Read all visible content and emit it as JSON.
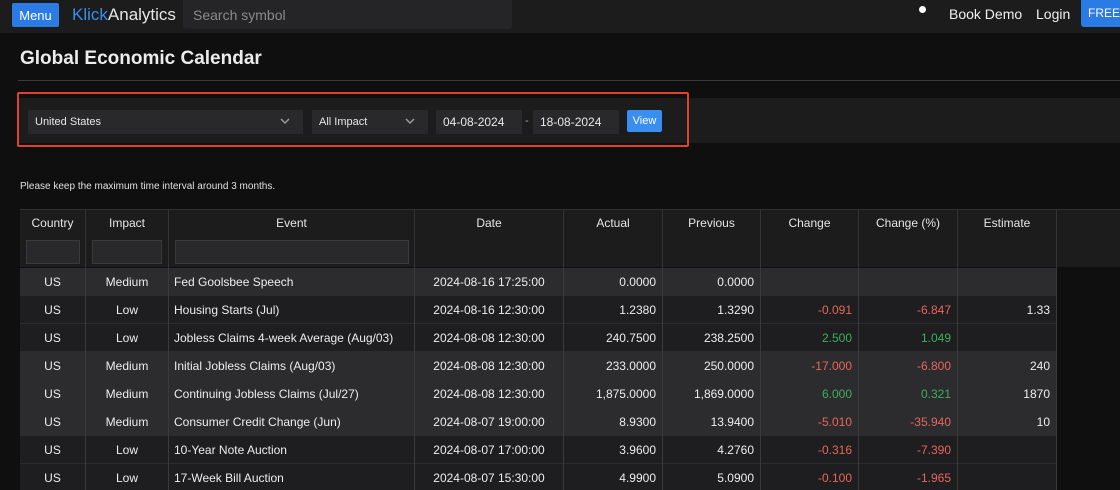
{
  "topbar": {
    "menu_label": "Menu",
    "logo_part1": "Klick",
    "logo_part2": "Analytics",
    "search_placeholder": "Search symbol",
    "book_demo": "Book Demo",
    "login": "Login",
    "free_trial": "FREE T"
  },
  "page": {
    "title": "Global Economic Calendar",
    "note": "Please keep the maximum time interval around 3 months."
  },
  "filters": {
    "country": "United States",
    "impact": "All Impact",
    "date_from": "04-08-2024",
    "date_separator": "-",
    "date_to": "18-08-2024",
    "view_label": "View"
  },
  "table": {
    "headers": [
      "Country",
      "Impact",
      "Event",
      "Date",
      "Actual",
      "Previous",
      "Change",
      "Change (%)",
      "Estimate"
    ],
    "rows": [
      {
        "country": "US",
        "impact": "Medium",
        "event": "Fed Goolsbee Speech",
        "date": "2024-08-16 17:25:00",
        "actual": "0.0000",
        "previous": "0.0000",
        "change": "",
        "change_pct": "",
        "estimate": "",
        "sign": ""
      },
      {
        "country": "US",
        "impact": "Low",
        "event": "Housing Starts (Jul)",
        "date": "2024-08-16 12:30:00",
        "actual": "1.2380",
        "previous": "1.3290",
        "change": "-0.091",
        "change_pct": "-6.847",
        "estimate": "1.33",
        "sign": "neg"
      },
      {
        "country": "US",
        "impact": "Low",
        "event": "Jobless Claims 4-week Average (Aug/03)",
        "date": "2024-08-08 12:30:00",
        "actual": "240.7500",
        "previous": "238.2500",
        "change": "2.500",
        "change_pct": "1.049",
        "estimate": "",
        "sign": "pos"
      },
      {
        "country": "US",
        "impact": "Medium",
        "event": "Initial Jobless Claims (Aug/03)",
        "date": "2024-08-08 12:30:00",
        "actual": "233.0000",
        "previous": "250.0000",
        "change": "-17.000",
        "change_pct": "-6.800",
        "estimate": "240",
        "sign": "neg"
      },
      {
        "country": "US",
        "impact": "Medium",
        "event": "Continuing Jobless Claims (Jul/27)",
        "date": "2024-08-08 12:30:00",
        "actual": "1,875.0000",
        "previous": "1,869.0000",
        "change": "6.000",
        "change_pct": "0.321",
        "estimate": "1870",
        "sign": "pos"
      },
      {
        "country": "US",
        "impact": "Medium",
        "event": "Consumer Credit Change (Jun)",
        "date": "2024-08-07 19:00:00",
        "actual": "8.9300",
        "previous": "13.9400",
        "change": "-5.010",
        "change_pct": "-35.940",
        "estimate": "10",
        "sign": "neg"
      },
      {
        "country": "US",
        "impact": "Low",
        "event": "10-Year Note Auction",
        "date": "2024-08-07 17:00:00",
        "actual": "3.9600",
        "previous": "4.2760",
        "change": "-0.316",
        "change_pct": "-7.390",
        "estimate": "",
        "sign": "neg"
      },
      {
        "country": "US",
        "impact": "Low",
        "event": "17-Week Bill Auction",
        "date": "2024-08-07 15:30:00",
        "actual": "4.9900",
        "previous": "5.0900",
        "change": "-0.100",
        "change_pct": "-1.965",
        "estimate": "",
        "sign": "neg"
      }
    ]
  },
  "colors": {
    "accent": "#2a7be4",
    "highlight_border": "#e0432c",
    "negative": "#e8665a",
    "positive": "#3fae5a"
  }
}
